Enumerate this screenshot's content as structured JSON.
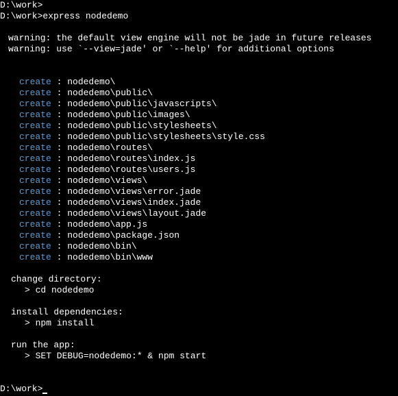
{
  "prompt1": {
    "path": "D:\\work>",
    "command": "express nodedemo"
  },
  "prompt0": {
    "path": "D:\\work>"
  },
  "warnings": [
    "warning: the default view engine will not be jade in future releases",
    "warning: use `--view=jade' or `--help' for additional options"
  ],
  "createLabel": "create",
  "sep": " : ",
  "creates": [
    "nodedemo\\",
    "nodedemo\\public\\",
    "nodedemo\\public\\javascripts\\",
    "nodedemo\\public\\images\\",
    "nodedemo\\public\\stylesheets\\",
    "nodedemo\\public\\stylesheets\\style.css",
    "nodedemo\\routes\\",
    "nodedemo\\routes\\index.js",
    "nodedemo\\routes\\users.js",
    "nodedemo\\views\\",
    "nodedemo\\views\\error.jade",
    "nodedemo\\views\\index.jade",
    "nodedemo\\views\\layout.jade",
    "nodedemo\\app.js",
    "nodedemo\\package.json",
    "nodedemo\\bin\\",
    "nodedemo\\bin\\www"
  ],
  "instructions": {
    "changeDir": "change directory:",
    "changeDirCmd": "> cd nodedemo",
    "installDeps": "install dependencies:",
    "installDepsCmd": "> npm install",
    "runApp": "run the app:",
    "runAppCmd": "> SET DEBUG=nodedemo:* & npm start"
  },
  "prompt2": {
    "path": "D:\\work>"
  }
}
